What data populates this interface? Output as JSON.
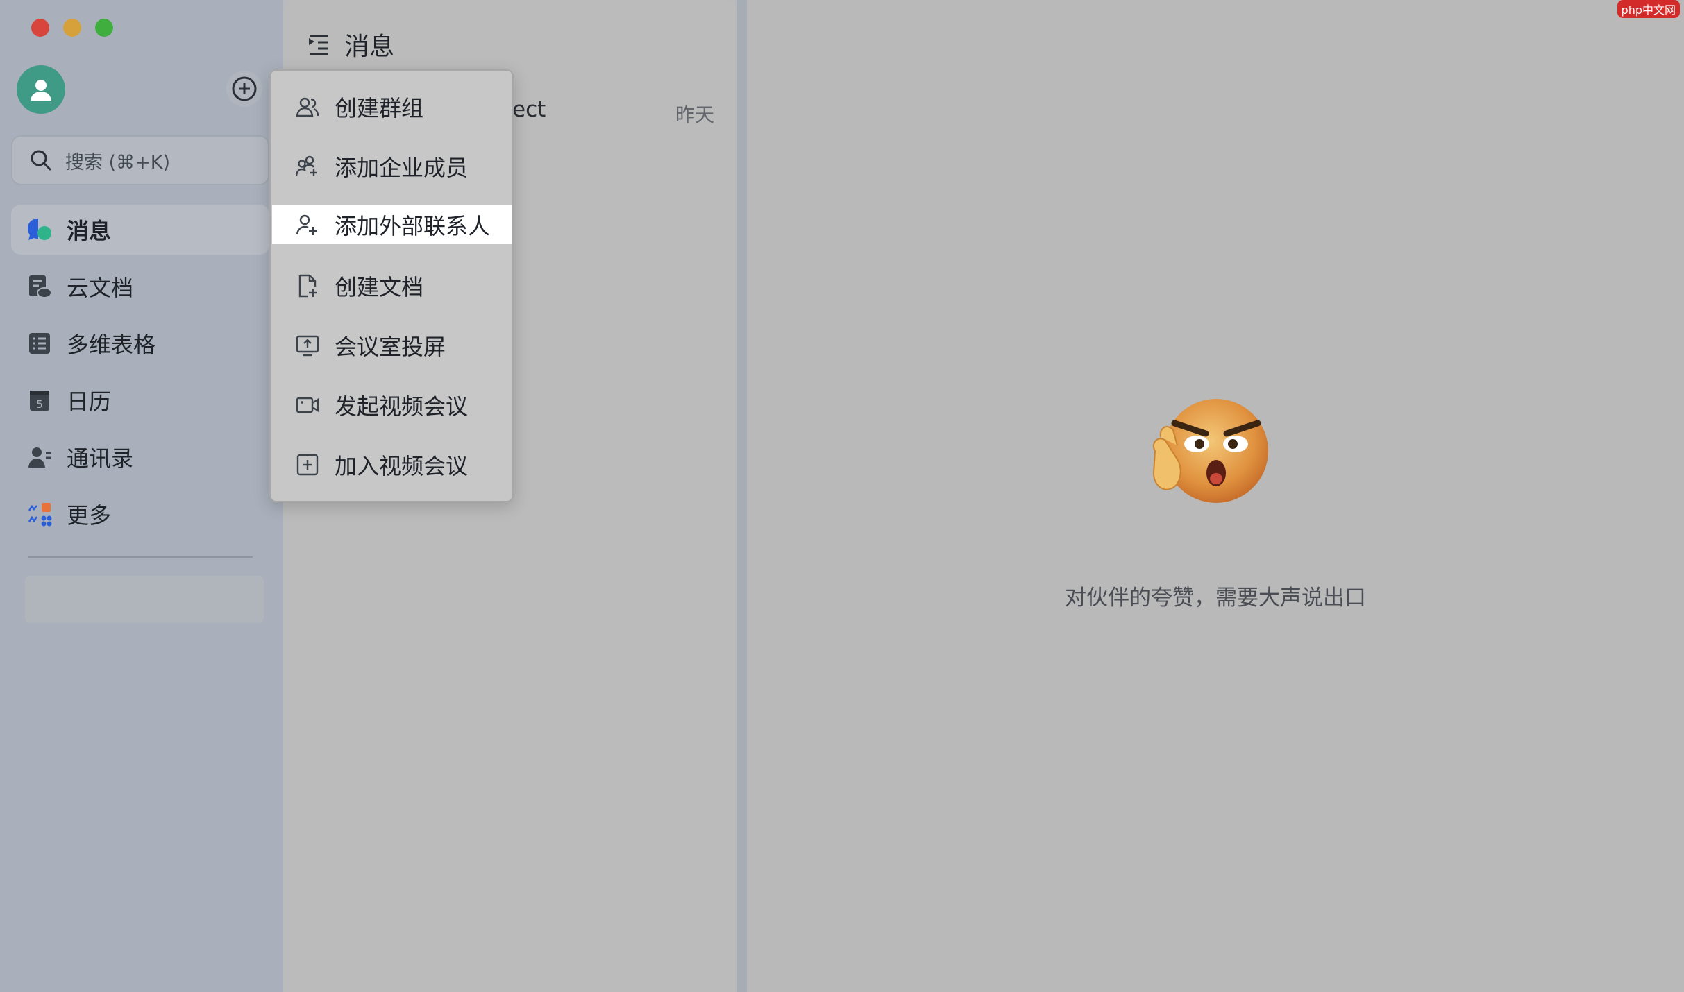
{
  "sidebar": {
    "search_placeholder": "搜索 (⌘+K)",
    "items": [
      {
        "label": "消息",
        "icon": "message-bubble-icon",
        "active": true
      },
      {
        "label": "云文档",
        "icon": "cloud-doc-icon"
      },
      {
        "label": "多维表格",
        "icon": "base-table-icon"
      },
      {
        "label": "日历",
        "icon": "calendar-icon",
        "date": "5"
      },
      {
        "label": "通讯录",
        "icon": "contacts-icon"
      },
      {
        "label": "更多",
        "icon": "more-apps-icon"
      }
    ]
  },
  "middle": {
    "title": "消息",
    "conversation": {
      "partial_name": "ect",
      "time": "昨天"
    }
  },
  "menu": {
    "items": [
      {
        "label": "创建群组",
        "icon": "group-icon"
      },
      {
        "label": "添加企业成员",
        "icon": "add-members-icon"
      },
      {
        "label": "添加外部联系人",
        "icon": "add-contact-icon",
        "highlighted": true
      },
      {
        "label": "创建文档",
        "icon": "new-doc-icon"
      },
      {
        "label": "会议室投屏",
        "icon": "screen-share-icon"
      },
      {
        "label": "发起视频会议",
        "icon": "video-camera-icon"
      },
      {
        "label": "加入视频会议",
        "icon": "join-meeting-icon"
      }
    ]
  },
  "right": {
    "empty_text": "对伙伴的夸赞，需要大声说出口"
  },
  "watermark": "php中文网",
  "colors": {
    "accent_blue": "#3370ff",
    "avatar_green": "#3f9a86",
    "traffic_red": "#d8453d",
    "traffic_yellow": "#d6a13a",
    "traffic_green": "#3fae3f"
  }
}
